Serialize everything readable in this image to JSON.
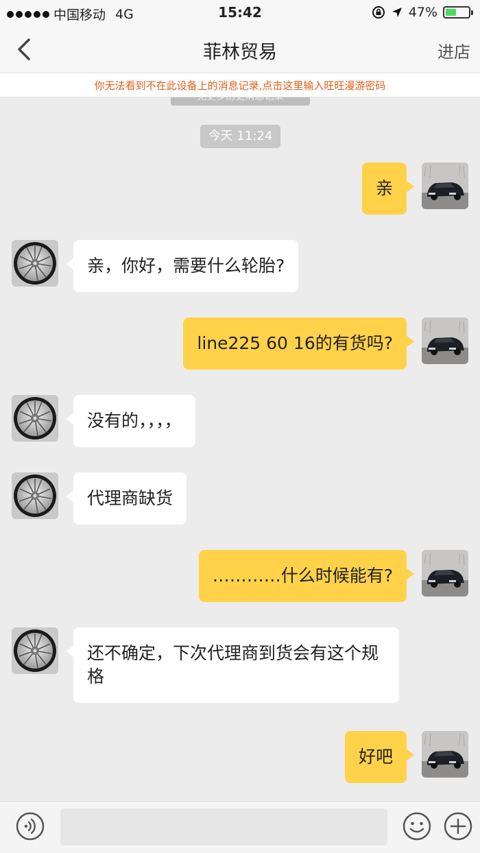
{
  "status_bar": {
    "carrier": "中国移动",
    "network": "4G",
    "time": "15:42",
    "battery_percent": "47%",
    "battery_level": 0.47
  },
  "nav": {
    "title": "菲林贸易",
    "enter_store": "进店"
  },
  "notice": {
    "text": "你无法看到不在此设备上的消息记录,点击这里输入旺旺漫游密码"
  },
  "chat": {
    "history_hint": "无更多历史消息记录",
    "timestamp": "今天 11:24",
    "messages": [
      {
        "from": "me",
        "text": "亲"
      },
      {
        "from": "them",
        "text": "亲，你好，需要什么轮胎?"
      },
      {
        "from": "me",
        "text": "line225 60 16的有货吗?"
      },
      {
        "from": "them",
        "text": "没有的，，，，"
      },
      {
        "from": "them",
        "text": "代理商缺货"
      },
      {
        "from": "me",
        "text": "…………什么时候能有?"
      },
      {
        "from": "them",
        "text": "还不确定，下次代理商到货会有这个规格"
      },
      {
        "from": "me",
        "text": "好吧"
      }
    ]
  },
  "input_bar": {
    "placeholder": ""
  },
  "icons": {
    "back": "chevron-left-icon",
    "voice": "voice-icon",
    "emoji": "emoji-icon",
    "plus": "plus-icon",
    "lock": "rotation-lock-icon",
    "location": "location-arrow-icon"
  },
  "colors": {
    "my_bubble": "#ffd24a",
    "their_bubble": "#ffffff",
    "notice_text": "#e0601a",
    "battery": "#4cd964"
  }
}
